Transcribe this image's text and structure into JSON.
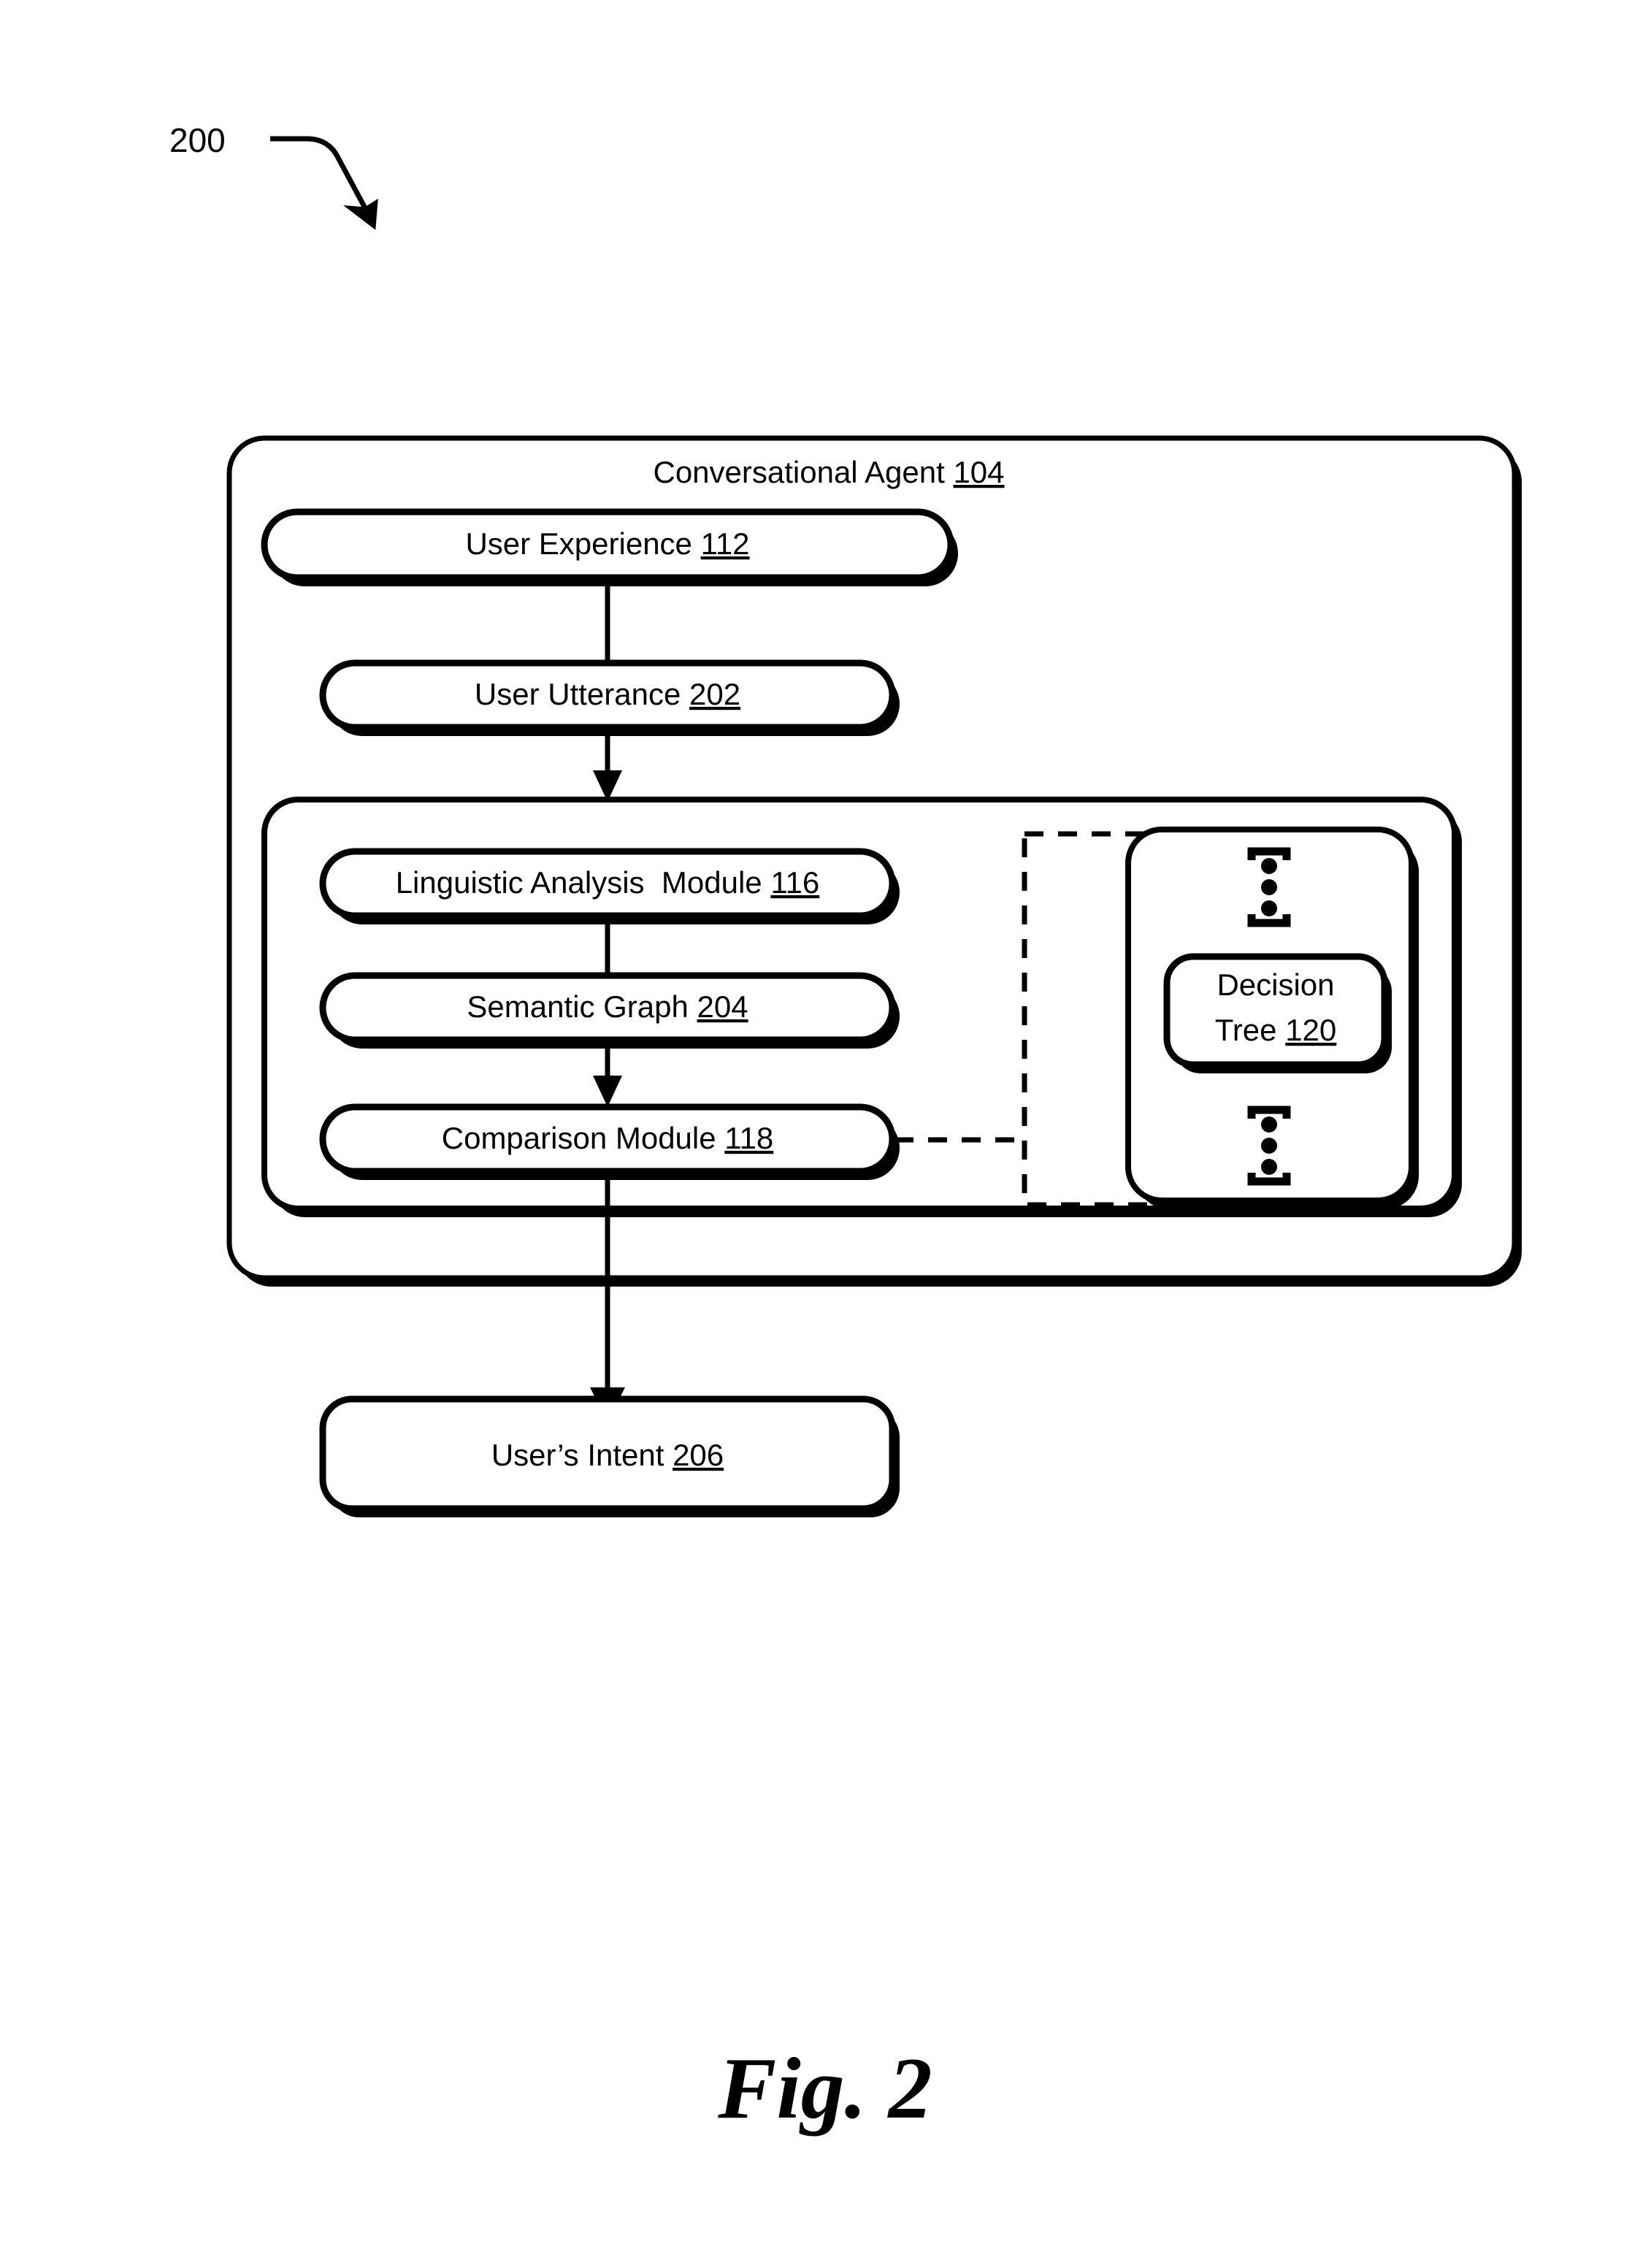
{
  "figure": {
    "number_callout": "200",
    "caption": "Fig. 2"
  },
  "outer_container": {
    "title_label": "Conversational Agent",
    "title_ref": "104"
  },
  "boxes": {
    "user_experience": {
      "label": "User Experience",
      "ref": "112"
    },
    "user_utterance": {
      "label": "User Utterance",
      "ref": "202"
    },
    "linguistic_analysis": {
      "label": "Linguistic Analysis  Module",
      "ref": "116"
    },
    "semantic_graph": {
      "label": "Semantic Graph",
      "ref": "204"
    },
    "comparison_module": {
      "label": "Comparison Module",
      "ref": "118"
    },
    "decision_tree": {
      "label_line1": "Decision",
      "label_line2": "Tree",
      "ref": "120"
    },
    "users_intent": {
      "label": "User’s Intent",
      "ref": "206"
    }
  },
  "icons": {
    "vertical_ellipsis_top": "vertical-ellipsis-bracket-icon",
    "vertical_ellipsis_bottom": "vertical-ellipsis-bracket-icon",
    "callout_arrow": "curved-arrow-icon"
  },
  "colors": {
    "stroke": "#000000",
    "fill": "#ffffff",
    "background": "#ffffff"
  }
}
